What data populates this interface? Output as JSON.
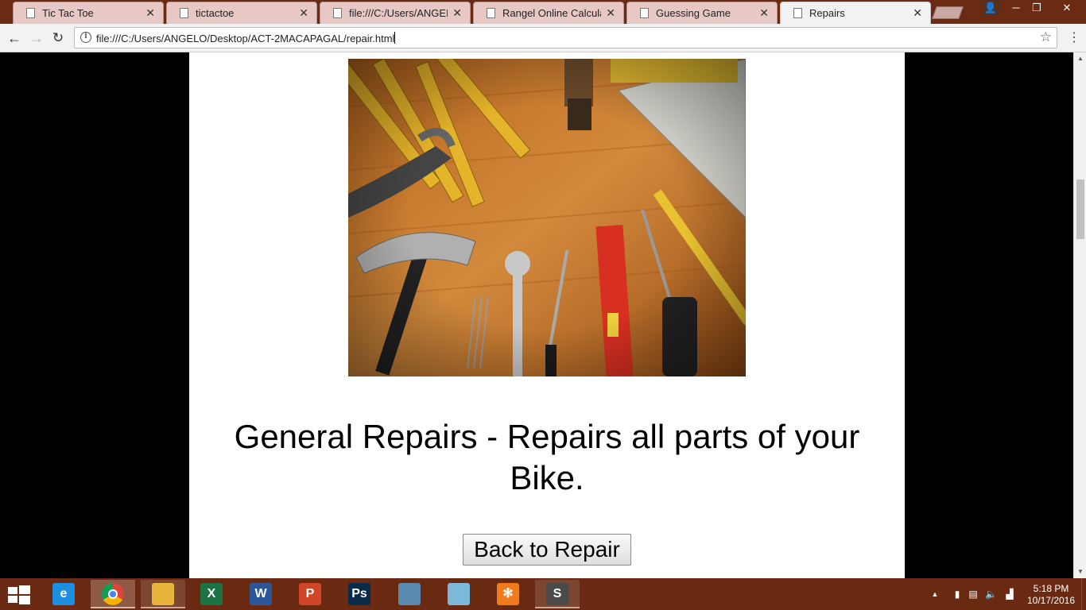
{
  "browser": {
    "tabs": [
      {
        "title": "Tic Tac Toe",
        "active": false
      },
      {
        "title": "tictactoe",
        "active": false
      },
      {
        "title": "file:///C:/Users/ANGELO/",
        "active": false
      },
      {
        "title": "Rangel Online Calculator",
        "active": false
      },
      {
        "title": "Guessing Game",
        "active": false
      },
      {
        "title": "Repairs",
        "active": true
      }
    ],
    "close_glyph": "✕",
    "url": "file:///C:/Users/ANGELO/Desktop/ACT-2MACAPAGAL/repair.html",
    "icons": {
      "back": "←",
      "forward": "→",
      "reload": "↻",
      "info": "i",
      "star": "☆",
      "menu": "⋮",
      "minimize": "─",
      "restore": "❐",
      "close": "✕",
      "profile": "👤"
    }
  },
  "page": {
    "heading": "General Repairs - Repairs all parts of your Bike.",
    "button_label": "Back to Repair",
    "image_semantic": "tools-on-wooden-table"
  },
  "taskbar": {
    "apps": [
      {
        "name": "Internet Explorer",
        "glyph": "e",
        "color": "#1e8fe0",
        "state": "none"
      },
      {
        "name": "Google Chrome",
        "glyph": "",
        "color": "#dd4b39",
        "state": "active"
      },
      {
        "name": "File Explorer",
        "glyph": "",
        "color": "#e8b53a",
        "state": "running"
      },
      {
        "name": "Excel",
        "glyph": "X",
        "color": "#1f7244",
        "state": "none"
      },
      {
        "name": "Word",
        "glyph": "W",
        "color": "#2b579a",
        "state": "none"
      },
      {
        "name": "PowerPoint",
        "glyph": "P",
        "color": "#d04525",
        "state": "none"
      },
      {
        "name": "Photoshop",
        "glyph": "Ps",
        "color": "#0a2a4a",
        "state": "none"
      },
      {
        "name": "MySQL Installer",
        "glyph": "",
        "color": "#5a8ab0",
        "state": "none"
      },
      {
        "name": "Notepad / Editor",
        "glyph": "",
        "color": "#7cb8d8",
        "state": "none"
      },
      {
        "name": "XAMPP",
        "glyph": "✻",
        "color": "#f07b1e",
        "state": "none"
      },
      {
        "name": "Sublime Text",
        "glyph": "S",
        "color": "#4a4a4a",
        "state": "running"
      }
    ],
    "tray": {
      "time": "5:18 PM",
      "date": "10/17/2016",
      "icons": {
        "chevron": "▲",
        "battery": "▮",
        "network": "▤",
        "volume": "🔈",
        "signal": "▟"
      }
    }
  }
}
